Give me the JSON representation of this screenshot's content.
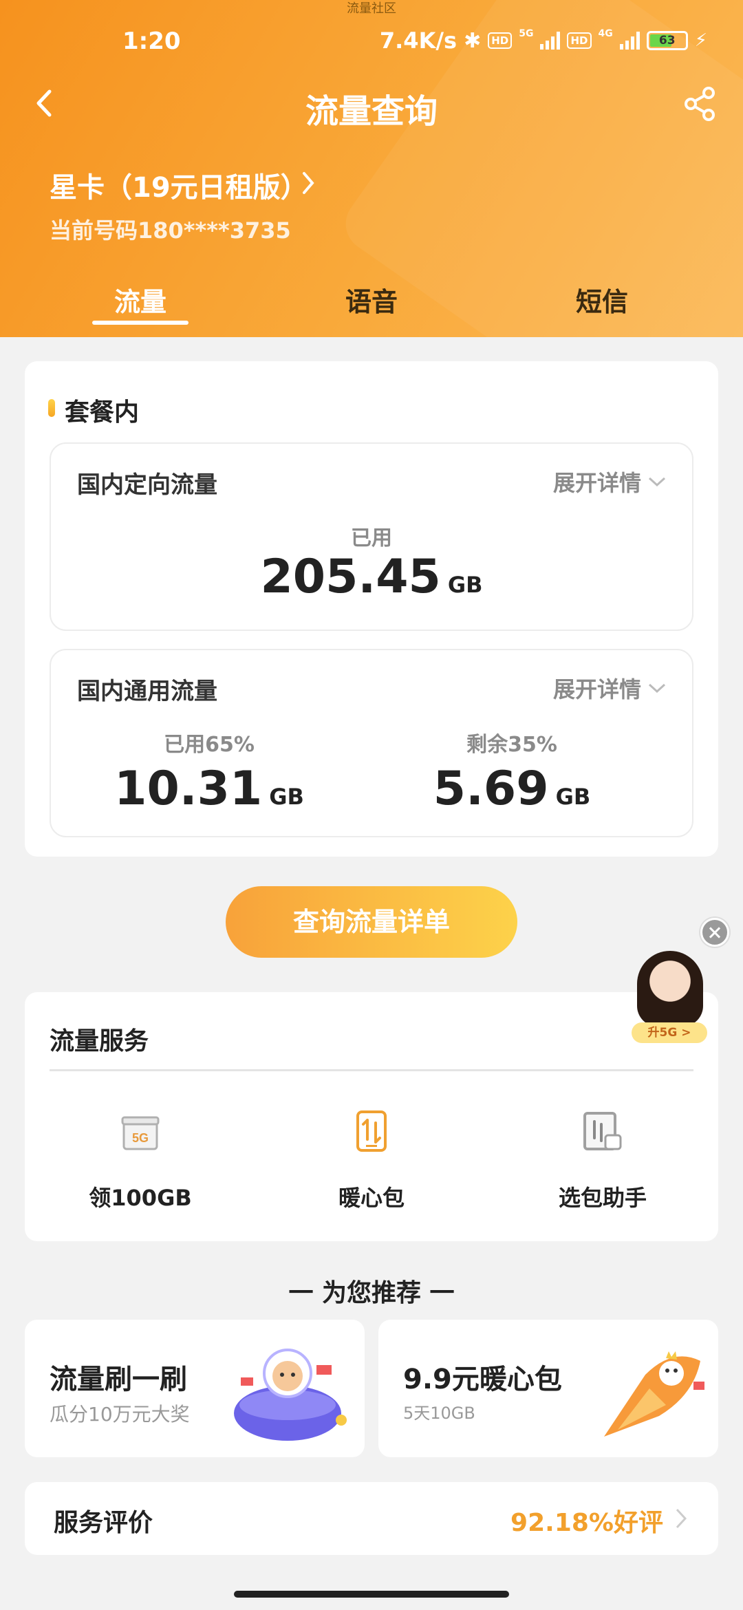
{
  "top_note": "流量社区",
  "status": {
    "time": "1:20",
    "speed": "7.4K/s",
    "net1": "5G",
    "net2": "4G",
    "battery": "63"
  },
  "nav": {
    "title": "流量查询"
  },
  "plan": {
    "name": "星卡（19元日租版）",
    "phone": "当前号码180****3735"
  },
  "tabs": [
    "流量",
    "语音",
    "短信"
  ],
  "package": {
    "section_title": "套餐内",
    "directed": {
      "title": "国内定向流量",
      "expand": "展开详情",
      "used_label": "已用",
      "used_value": "205.45",
      "unit": "GB"
    },
    "general": {
      "title": "国内通用流量",
      "expand": "展开详情",
      "used_label": "已用65%",
      "used_value": "10.31",
      "remain_label": "剩余35%",
      "remain_value": "5.69",
      "unit": "GB",
      "used_fraction": 0.65
    }
  },
  "query_button": "查询流量详单",
  "promo": {
    "tag": "升5G >"
  },
  "services": {
    "title": "流量服务",
    "items": [
      {
        "label": "领100GB",
        "icon": "gift-5g-icon"
      },
      {
        "label": "暖心包",
        "icon": "data-transfer-icon"
      },
      {
        "label": "选包助手",
        "icon": "package-assistant-icon"
      }
    ]
  },
  "recommend": {
    "title": "一 为您推荐 一",
    "cards": [
      {
        "title": "流量刷一刷",
        "subtitle": "瓜分10万元大奖"
      },
      {
        "title": "9.9元暖心包",
        "subtitle": "5天10GB"
      }
    ]
  },
  "rating": {
    "label": "服务评价",
    "value": "92.18%好评"
  },
  "colors": {
    "header_start": "#f6921e",
    "header_end": "#fbb957",
    "accent": "#f2a02c"
  }
}
